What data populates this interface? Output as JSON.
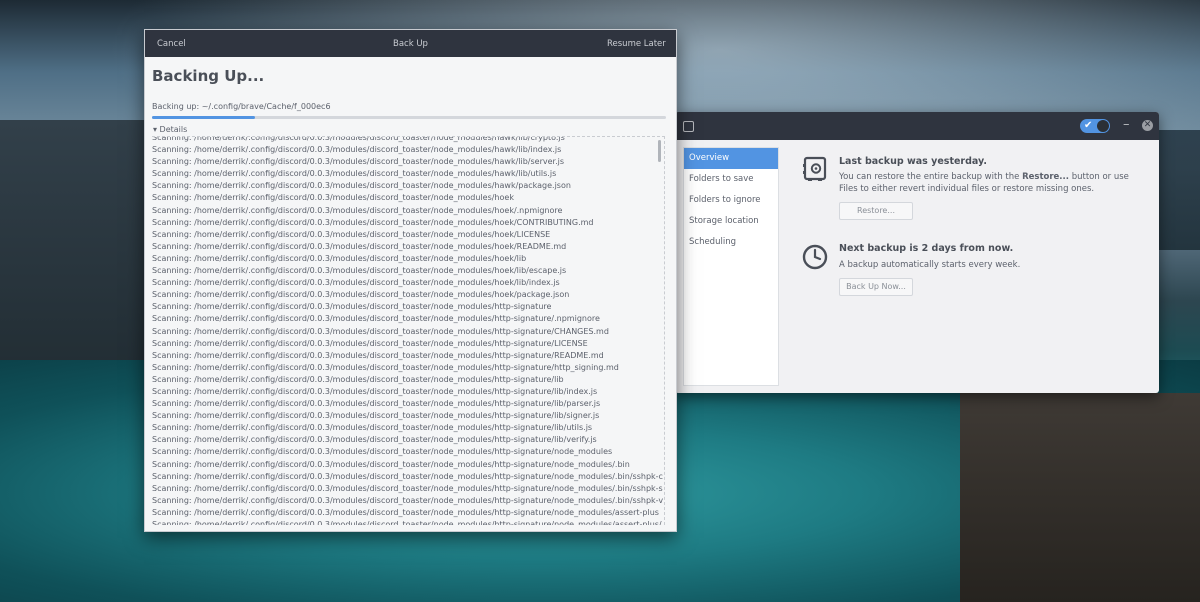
{
  "backup_dialog": {
    "titlebar": {
      "cancel": "Cancel",
      "title": "Back Up",
      "resume": "Resume Later"
    },
    "heading": "Backing Up...",
    "status": "Backing up: ~/.config/brave/Cache/f_000ec6",
    "progress_percent": 20,
    "details_label": "▾ Details",
    "log_lines": [
      "Scanning: /home/derrik/.config/discord/0.0.3/modules/discord_toaster/node_modules/hawk/lib/crypto.js",
      "Scanning: /home/derrik/.config/discord/0.0.3/modules/discord_toaster/node_modules/hawk/lib/index.js",
      "Scanning: /home/derrik/.config/discord/0.0.3/modules/discord_toaster/node_modules/hawk/lib/server.js",
      "Scanning: /home/derrik/.config/discord/0.0.3/modules/discord_toaster/node_modules/hawk/lib/utils.js",
      "Scanning: /home/derrik/.config/discord/0.0.3/modules/discord_toaster/node_modules/hawk/package.json",
      "Scanning: /home/derrik/.config/discord/0.0.3/modules/discord_toaster/node_modules/hoek",
      "Scanning: /home/derrik/.config/discord/0.0.3/modules/discord_toaster/node_modules/hoek/.npmignore",
      "Scanning: /home/derrik/.config/discord/0.0.3/modules/discord_toaster/node_modules/hoek/CONTRIBUTING.md",
      "Scanning: /home/derrik/.config/discord/0.0.3/modules/discord_toaster/node_modules/hoek/LICENSE",
      "Scanning: /home/derrik/.config/discord/0.0.3/modules/discord_toaster/node_modules/hoek/README.md",
      "Scanning: /home/derrik/.config/discord/0.0.3/modules/discord_toaster/node_modules/hoek/lib",
      "Scanning: /home/derrik/.config/discord/0.0.3/modules/discord_toaster/node_modules/hoek/lib/escape.js",
      "Scanning: /home/derrik/.config/discord/0.0.3/modules/discord_toaster/node_modules/hoek/lib/index.js",
      "Scanning: /home/derrik/.config/discord/0.0.3/modules/discord_toaster/node_modules/hoek/package.json",
      "Scanning: /home/derrik/.config/discord/0.0.3/modules/discord_toaster/node_modules/http-signature",
      "Scanning: /home/derrik/.config/discord/0.0.3/modules/discord_toaster/node_modules/http-signature/.npmignore",
      "Scanning: /home/derrik/.config/discord/0.0.3/modules/discord_toaster/node_modules/http-signature/CHANGES.md",
      "Scanning: /home/derrik/.config/discord/0.0.3/modules/discord_toaster/node_modules/http-signature/LICENSE",
      "Scanning: /home/derrik/.config/discord/0.0.3/modules/discord_toaster/node_modules/http-signature/README.md",
      "Scanning: /home/derrik/.config/discord/0.0.3/modules/discord_toaster/node_modules/http-signature/http_signing.md",
      "Scanning: /home/derrik/.config/discord/0.0.3/modules/discord_toaster/node_modules/http-signature/lib",
      "Scanning: /home/derrik/.config/discord/0.0.3/modules/discord_toaster/node_modules/http-signature/lib/index.js",
      "Scanning: /home/derrik/.config/discord/0.0.3/modules/discord_toaster/node_modules/http-signature/lib/parser.js",
      "Scanning: /home/derrik/.config/discord/0.0.3/modules/discord_toaster/node_modules/http-signature/lib/signer.js",
      "Scanning: /home/derrik/.config/discord/0.0.3/modules/discord_toaster/node_modules/http-signature/lib/utils.js",
      "Scanning: /home/derrik/.config/discord/0.0.3/modules/discord_toaster/node_modules/http-signature/lib/verify.js",
      "Scanning: /home/derrik/.config/discord/0.0.3/modules/discord_toaster/node_modules/http-signature/node_modules",
      "Scanning: /home/derrik/.config/discord/0.0.3/modules/discord_toaster/node_modules/http-signature/node_modules/.bin",
      "Scanning: /home/derrik/.config/discord/0.0.3/modules/discord_toaster/node_modules/http-signature/node_modules/.bin/sshpk-c",
      "Scanning: /home/derrik/.config/discord/0.0.3/modules/discord_toaster/node_modules/http-signature/node_modules/.bin/sshpk-s",
      "Scanning: /home/derrik/.config/discord/0.0.3/modules/discord_toaster/node_modules/http-signature/node_modules/.bin/sshpk-v",
      "Scanning: /home/derrik/.config/discord/0.0.3/modules/discord_toaster/node_modules/http-signature/node_modules/assert-plus",
      "Scanning: /home/derrik/.config/discord/0.0.3/modules/discord_toaster/node_modules/http-signature/node_modules/assert-plus/"
    ]
  },
  "deja_window": {
    "toggle_check": "✔",
    "minimize": "–",
    "close": "✕",
    "sidebar": [
      {
        "label": "Overview",
        "active": true
      },
      {
        "label": "Folders to save",
        "active": false
      },
      {
        "label": "Folders to ignore",
        "active": false
      },
      {
        "label": "Storage location",
        "active": false
      },
      {
        "label": "Scheduling",
        "active": false
      }
    ],
    "last_backup": {
      "title": "Last backup was yesterday.",
      "text_pre": "You can restore the entire backup with the ",
      "text_bold": "Restore...",
      "text_post": " button or use Files to either revert individual files or restore missing ones.",
      "button": "Restore..."
    },
    "next_backup": {
      "title": "Next backup is 2 days from now.",
      "text": "A backup automatically starts every week.",
      "button": "Back Up Now..."
    }
  },
  "colors": {
    "accent": "#5294e2",
    "titlebar": "#2f343f",
    "text": "#5c616c"
  }
}
